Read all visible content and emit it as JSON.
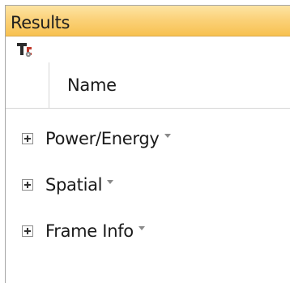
{
  "panel": {
    "title": "Results"
  },
  "toolbar": {
    "items": [
      {
        "icon": "tc-options-icon"
      }
    ]
  },
  "columns": {
    "name": "Name"
  },
  "tree": {
    "items": [
      {
        "label": "Power/Energy"
      },
      {
        "label": "Spatial"
      },
      {
        "label": "Frame Info"
      }
    ]
  },
  "colors": {
    "title_bar_top": "#fde4a3",
    "title_bar_bottom": "#f7c150",
    "border": "#a7a7a7"
  }
}
